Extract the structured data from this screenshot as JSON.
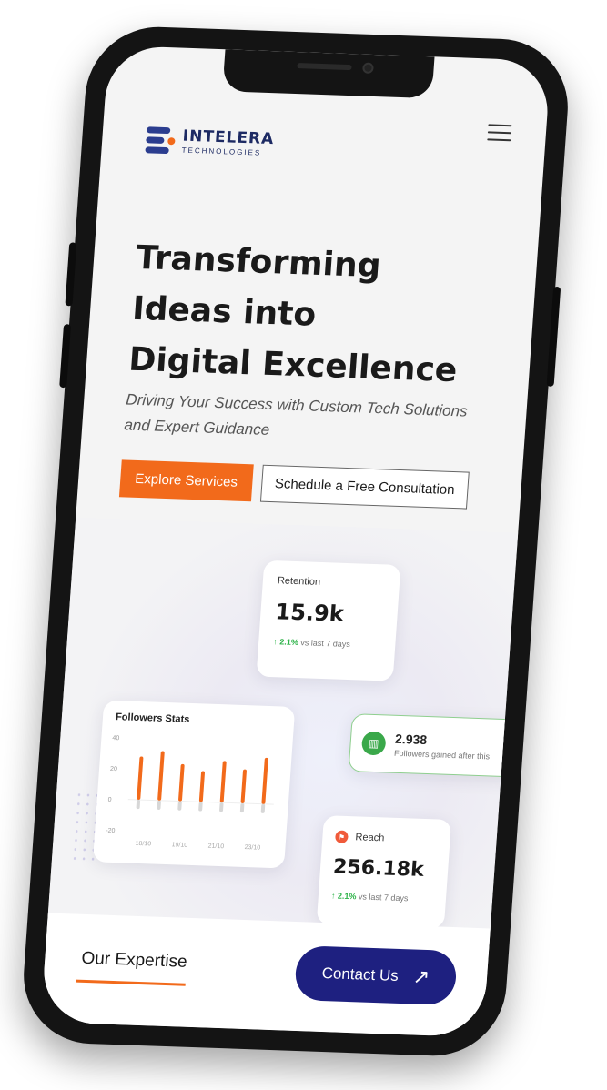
{
  "brand": {
    "name": "INTELERA",
    "sub": "TECHNOLOGIES"
  },
  "hero": {
    "title_lines": [
      "Transforming",
      "Ideas into",
      "Digital Excellence"
    ],
    "subtitle": "Driving Your Success with Custom Tech Solutions and Expert Guidance",
    "primary_cta": "Explore Services",
    "secondary_cta": "Schedule a Free Consultation"
  },
  "cards": {
    "retention": {
      "label": "Retention",
      "value": "15.9k",
      "delta": "2.1%",
      "delta_suffix": "vs last 7 days"
    },
    "followers": {
      "title": "Followers Stats"
    },
    "gained": {
      "value": "2.938",
      "text": "Followers gained after this"
    },
    "reach": {
      "label": "Reach",
      "value": "256.18k",
      "delta": "2.1%",
      "delta_suffix": "vs last 7 days"
    }
  },
  "chart_data": {
    "type": "bar",
    "title": "Followers Stats",
    "y_ticks": [
      "40",
      "20",
      "0",
      "-20"
    ],
    "ylim": [
      -20,
      40
    ],
    "x_ticks": [
      "18/10",
      "19/10",
      "21/10",
      "23/10"
    ],
    "values": [
      28,
      32,
      24,
      20,
      27,
      22,
      30
    ],
    "negatives": [
      -6,
      -6,
      -6,
      -6,
      -6,
      -6,
      -6
    ],
    "colors": {
      "positive": "#f26a1b",
      "negative": "#d7d7d7"
    }
  },
  "bottom": {
    "expertise_label": "Our Expertise",
    "contact_label": "Contact Us"
  },
  "icons": {
    "menu": "hamburger-icon",
    "arrow": "arrow-up-right-icon",
    "gained": "bar-chart-icon",
    "reach": "flag-icon"
  },
  "colors": {
    "accent": "#f26a1b",
    "brand_navy": "#1e2080",
    "positive": "#2fb34a"
  }
}
